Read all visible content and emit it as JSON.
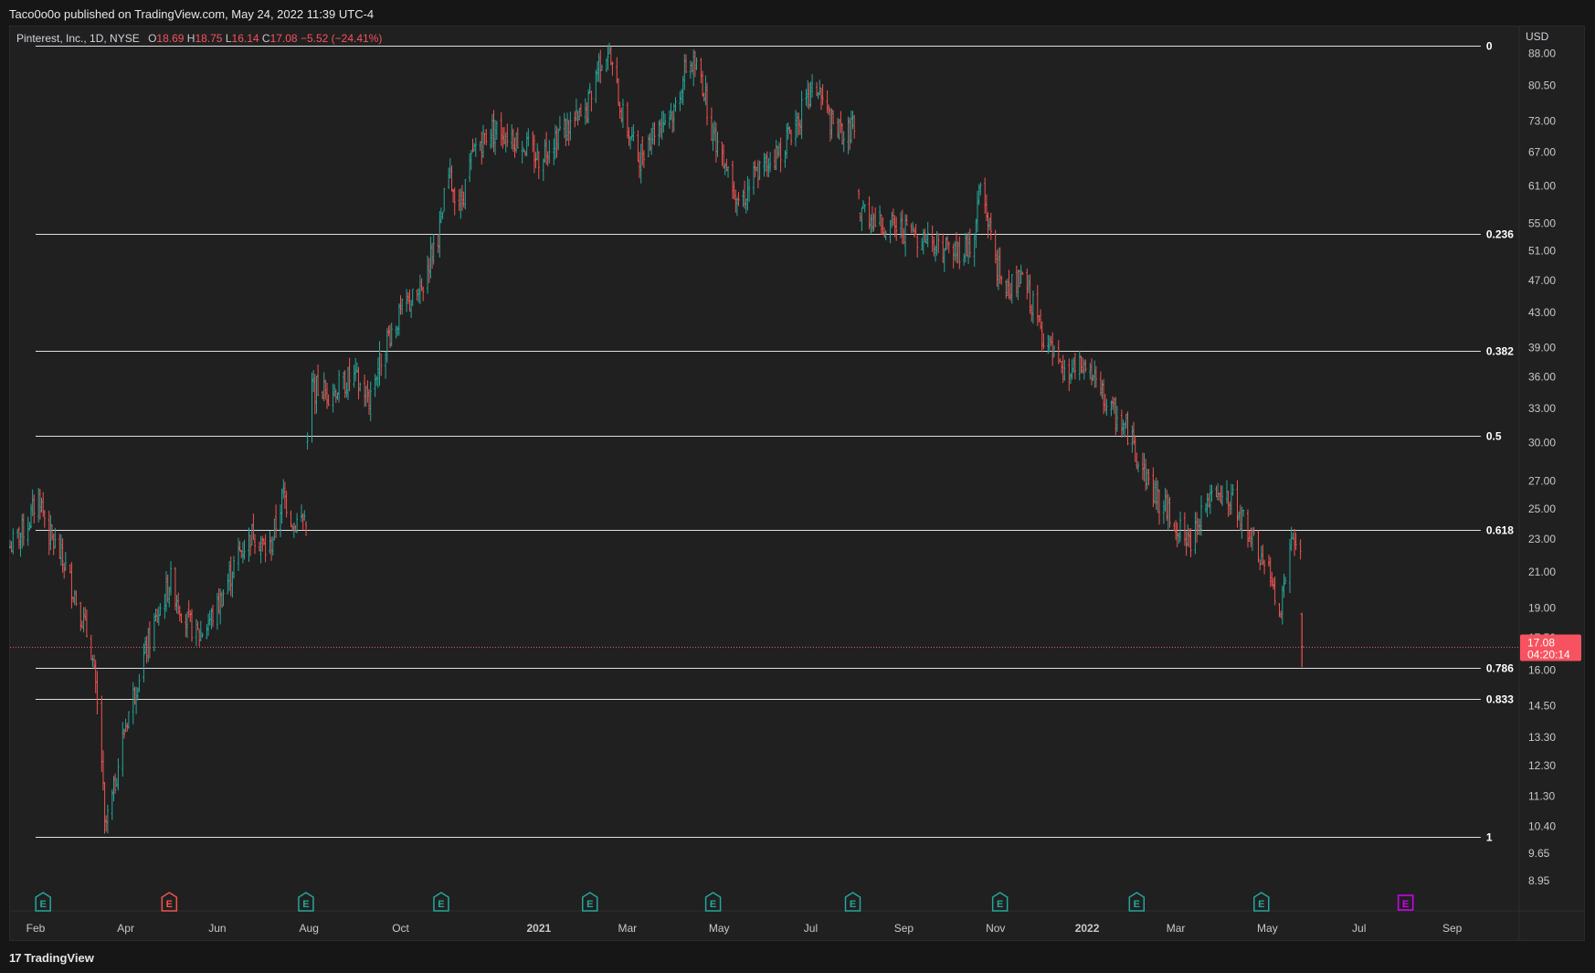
{
  "header": {
    "published": "Taco0o0o published on TradingView.com, May 24, 2022 11:39 UTC-4"
  },
  "symbol": {
    "name": "Pinterest, Inc., 1D, NYSE",
    "o_label": "O",
    "o": "18.69",
    "h_label": "H",
    "h": "18.75",
    "l_label": "L",
    "l": "16.14",
    "c_label": "C",
    "c": "17.08",
    "change": "−5.52 (−24.41%)"
  },
  "brand": {
    "logo": "17",
    "name": "TradingView"
  },
  "colors": {
    "background": "#202020",
    "up": "#26a69a",
    "down": "#ef5350",
    "fib": "#e0e0e0",
    "price_tag": "#f7525f",
    "earnings_future": "#d500f9"
  },
  "chart_data": {
    "type": "candlestick",
    "currency": "USD",
    "scale": "log",
    "ylim": [
      8.7,
      95
    ],
    "y_ticks": [
      "88.00",
      "80.50",
      "73.00",
      "67.00",
      "61.00",
      "55.00",
      "51.00",
      "47.00",
      "43.00",
      "39.00",
      "36.00",
      "33.00",
      "30.00",
      "27.00",
      "25.00",
      "23.00",
      "21.00",
      "19.00",
      "17.50",
      "16.00",
      "14.50",
      "13.30",
      "12.30",
      "11.30",
      "10.40",
      "9.65",
      "8.95"
    ],
    "x_ticks": [
      {
        "label": "Feb",
        "date": "2020-02-01",
        "bold": false
      },
      {
        "label": "Apr",
        "date": "2020-04-01",
        "bold": false
      },
      {
        "label": "Jun",
        "date": "2020-06-01",
        "bold": false
      },
      {
        "label": "Aug",
        "date": "2020-08-01",
        "bold": false
      },
      {
        "label": "Oct",
        "date": "2020-10-01",
        "bold": false
      },
      {
        "label": "2021",
        "date": "2021-01-01",
        "bold": true
      },
      {
        "label": "Mar",
        "date": "2021-03-01",
        "bold": false
      },
      {
        "label": "May",
        "date": "2021-05-01",
        "bold": false
      },
      {
        "label": "Jul",
        "date": "2021-07-01",
        "bold": false
      },
      {
        "label": "Sep",
        "date": "2021-09-01",
        "bold": false
      },
      {
        "label": "Nov",
        "date": "2021-11-01",
        "bold": false
      },
      {
        "label": "2022",
        "date": "2022-01-01",
        "bold": true
      },
      {
        "label": "Mar",
        "date": "2022-03-01",
        "bold": false
      },
      {
        "label": "May",
        "date": "2022-05-01",
        "bold": false
      },
      {
        "label": "Jul",
        "date": "2022-07-01",
        "bold": false
      },
      {
        "label": "Sep",
        "date": "2022-09-01",
        "bold": false
      }
    ],
    "xlim": [
      "2020-01-15",
      "2022-10-15"
    ],
    "fib_levels": [
      {
        "label": "0",
        "price": 89.9
      },
      {
        "label": "0.236",
        "price": 53.4
      },
      {
        "label": "0.382",
        "price": 38.7
      },
      {
        "label": "0.5",
        "price": 30.6
      },
      {
        "label": "0.618",
        "price": 23.6
      },
      {
        "label": "0.786",
        "price": 16.1
      },
      {
        "label": "0.833",
        "price": 14.8
      },
      {
        "label": "1",
        "price": 10.1
      }
    ],
    "fib_start": "2020-02-01",
    "fib_end": "2022-09-20",
    "last_price": {
      "price": 17.08,
      "label": "17.08",
      "countdown": "04:20:14"
    },
    "earnings": [
      {
        "date": "2020-02-06",
        "kind": "past"
      },
      {
        "date": "2020-04-30",
        "kind": "past-red"
      },
      {
        "date": "2020-07-30",
        "kind": "past"
      },
      {
        "date": "2020-10-28",
        "kind": "past"
      },
      {
        "date": "2021-02-04",
        "kind": "past"
      },
      {
        "date": "2021-04-27",
        "kind": "past"
      },
      {
        "date": "2021-07-29",
        "kind": "past"
      },
      {
        "date": "2021-11-04",
        "kind": "past"
      },
      {
        "date": "2022-02-03",
        "kind": "past"
      },
      {
        "date": "2022-04-27",
        "kind": "past"
      },
      {
        "date": "2022-08-01",
        "kind": "future"
      }
    ],
    "earnings_label": "E",
    "price_path": [
      [
        "2020-01-15",
        22.5
      ],
      [
        "2020-01-27",
        24.0
      ],
      [
        "2020-02-03",
        26.0
      ],
      [
        "2020-02-10",
        23.3
      ],
      [
        "2020-02-20",
        21.5
      ],
      [
        "2020-03-01",
        19.0
      ],
      [
        "2020-03-09",
        17.0
      ],
      [
        "2020-03-16",
        12.5
      ],
      [
        "2020-03-18",
        10.3
      ],
      [
        "2020-03-23",
        11.2
      ],
      [
        "2020-04-01",
        13.8
      ],
      [
        "2020-04-15",
        17.0
      ],
      [
        "2020-05-01",
        20.5
      ],
      [
        "2020-05-10",
        18.5
      ],
      [
        "2020-05-20",
        17.6
      ],
      [
        "2020-06-01",
        19.0
      ],
      [
        "2020-06-15",
        22.0
      ],
      [
        "2020-06-25",
        23.5
      ],
      [
        "2020-07-05",
        22.0
      ],
      [
        "2020-07-15",
        26.0
      ],
      [
        "2020-07-22",
        24.0
      ],
      [
        "2020-07-30",
        24.5
      ],
      [
        "2020-08-01",
        35.0
      ],
      [
        "2020-08-15",
        34.5
      ],
      [
        "2020-08-30",
        36.0
      ],
      [
        "2020-09-10",
        34.0
      ],
      [
        "2020-09-22",
        40.0
      ],
      [
        "2020-10-05",
        44.0
      ],
      [
        "2020-10-15",
        45.5
      ],
      [
        "2020-10-21",
        50.5
      ],
      [
        "2020-10-28",
        54.5
      ],
      [
        "2020-11-01",
        63.0
      ],
      [
        "2020-11-10",
        58.0
      ],
      [
        "2020-11-20",
        68.0
      ],
      [
        "2020-12-01",
        71.5
      ],
      [
        "2020-12-15",
        70.0
      ],
      [
        "2021-01-01",
        66.0
      ],
      [
        "2021-01-15",
        71.0
      ],
      [
        "2021-02-01",
        74.0
      ],
      [
        "2021-02-10",
        86.0
      ],
      [
        "2021-02-16",
        88.5
      ],
      [
        "2021-02-25",
        75.0
      ],
      [
        "2021-03-08",
        66.0
      ],
      [
        "2021-03-20",
        72.0
      ],
      [
        "2021-04-01",
        75.0
      ],
      [
        "2021-04-10",
        86.0
      ],
      [
        "2021-04-18",
        84.0
      ],
      [
        "2021-04-27",
        70.0
      ],
      [
        "2021-05-05",
        66.0
      ],
      [
        "2021-05-15",
        58.0
      ],
      [
        "2021-05-25",
        63.0
      ],
      [
        "2021-06-10",
        67.0
      ],
      [
        "2021-06-25",
        75.0
      ],
      [
        "2021-07-05",
        80.0
      ],
      [
        "2021-07-15",
        72.0
      ],
      [
        "2021-07-25",
        70.0
      ],
      [
        "2021-07-29",
        73.0
      ],
      [
        "2021-08-02",
        58.0
      ],
      [
        "2021-08-15",
        55.0
      ],
      [
        "2021-09-01",
        54.0
      ],
      [
        "2021-09-20",
        52.5
      ],
      [
        "2021-10-05",
        51.0
      ],
      [
        "2021-10-18",
        52.0
      ],
      [
        "2021-10-20",
        58.0
      ],
      [
        "2021-10-22",
        61.0
      ],
      [
        "2021-11-05",
        46.0
      ],
      [
        "2021-11-20",
        47.0
      ],
      [
        "2021-12-01",
        41.0
      ],
      [
        "2021-12-15",
        36.0
      ],
      [
        "2022-01-01",
        37.0
      ],
      [
        "2022-01-15",
        33.0
      ],
      [
        "2022-01-28",
        31.0
      ],
      [
        "2022-02-03",
        29.0
      ],
      [
        "2022-02-15",
        26.0
      ],
      [
        "2022-03-01",
        24.0
      ],
      [
        "2022-03-10",
        22.5
      ],
      [
        "2022-03-20",
        25.5
      ],
      [
        "2022-04-01",
        25.5
      ],
      [
        "2022-04-10",
        25.5
      ],
      [
        "2022-04-20",
        23.0
      ],
      [
        "2022-05-01",
        21.0
      ],
      [
        "2022-05-10",
        19.0
      ],
      [
        "2022-05-16",
        22.5
      ],
      [
        "2022-05-23",
        22.6
      ],
      [
        "2022-05-24",
        17.08
      ]
    ]
  }
}
